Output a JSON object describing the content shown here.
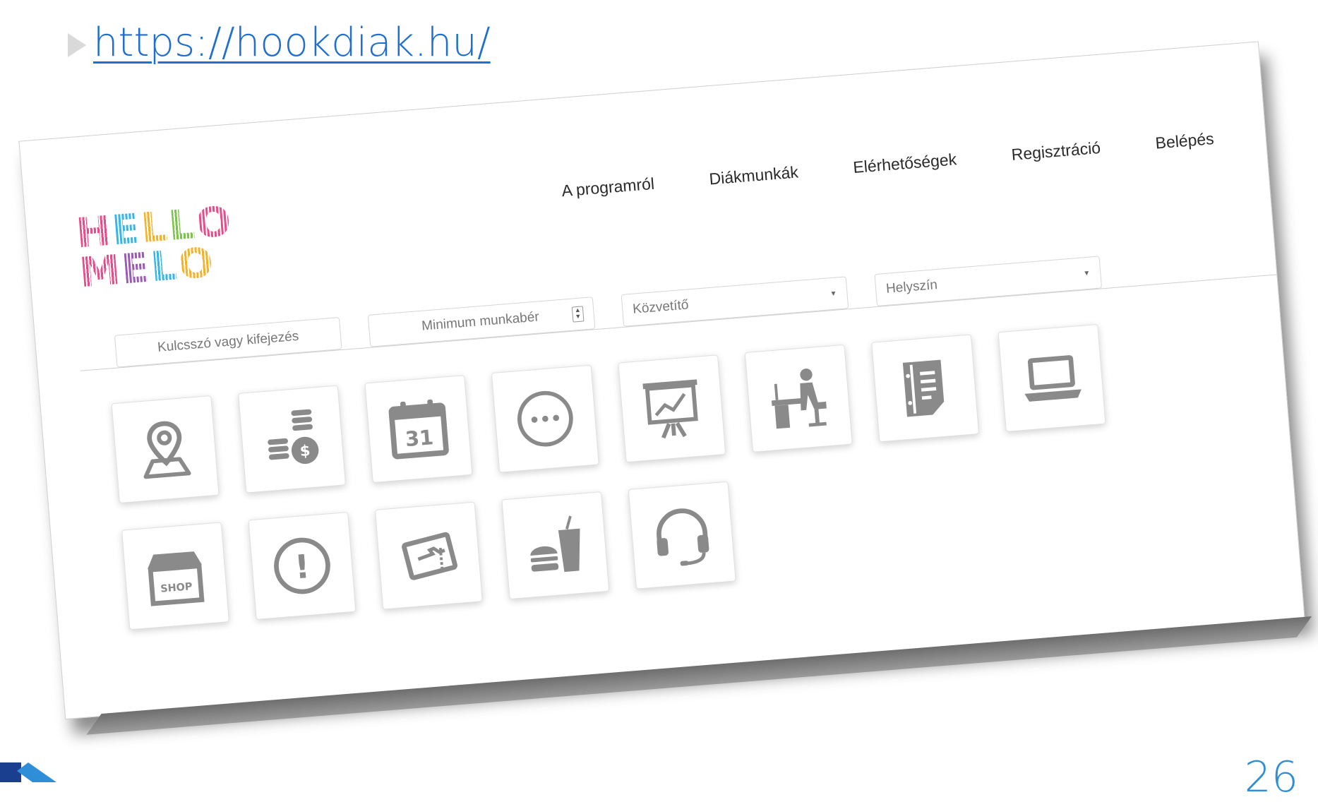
{
  "slide": {
    "link_text": "https://hookdiak.hu/",
    "page_number": "26"
  },
  "site": {
    "logo_text": [
      "HELLO",
      "MELO"
    ],
    "logo_colors": [
      "#e94b8a",
      "#f6b227",
      "#35b6e8",
      "#7bc64a",
      "#9b59b6"
    ],
    "nav": [
      {
        "label": "A programról"
      },
      {
        "label": "Diákmunkák"
      },
      {
        "label": "Elérhetőségek"
      },
      {
        "label": "Regisztráció"
      },
      {
        "label": "Belépés"
      }
    ],
    "filters": {
      "keyword_placeholder": "Kulcsszó vagy kifejezés",
      "min_wage_placeholder": "Minimum munkabér",
      "agency_placeholder": "Közvetítő",
      "location_placeholder": "Helyszín"
    },
    "categories": [
      {
        "icon": "map-pin-icon"
      },
      {
        "icon": "coins-icon"
      },
      {
        "icon": "calendar-icon",
        "text": "31"
      },
      {
        "icon": "more-dots-icon"
      },
      {
        "icon": "presentation-chart-icon"
      },
      {
        "icon": "office-worker-icon"
      },
      {
        "icon": "document-icon"
      },
      {
        "icon": "laptop-icon"
      },
      {
        "icon": "shop-icon",
        "text": "SHOP"
      },
      {
        "icon": "alert-icon",
        "text": "!"
      },
      {
        "icon": "ticket-icon"
      },
      {
        "icon": "fast-food-icon"
      },
      {
        "icon": "headset-icon"
      }
    ],
    "icon_color": "#8a8a8a"
  }
}
